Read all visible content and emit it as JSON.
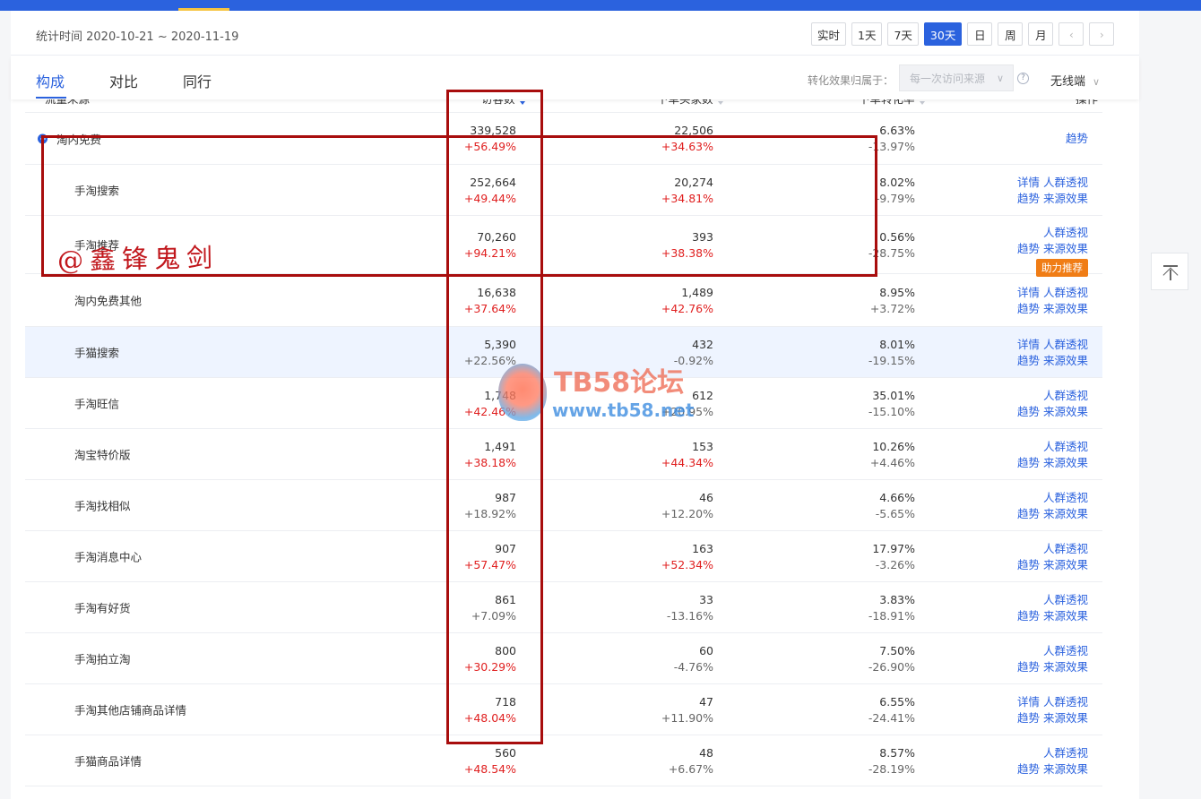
{
  "stat_time": "统计时间 2020-10-21 ~ 2020-11-19",
  "ranges": [
    "实时",
    "1天",
    "7天",
    "30天",
    "日",
    "周",
    "月"
  ],
  "active_range": "30天",
  "tabs": [
    "构成",
    "对比",
    "同行"
  ],
  "attribution_label": "转化效果归属于：",
  "attribution_value": "每一次访问来源",
  "device_value": "无线端",
  "columns": {
    "source": "流量来源",
    "visitors": "访客数",
    "buyers": "下单买家数",
    "conversion": "下单转化率",
    "ops": "操作"
  },
  "rows": [
    {
      "name": "淘内免费",
      "visitors": "339,528",
      "visitors_change": "+56.49%",
      "buyers": "22,506",
      "buyers_change": "+34.63%",
      "conv": "6.63%",
      "conv_change": "-13.97%",
      "ops_line1": "趋势",
      "ops_line2": ""
    },
    {
      "name": "手淘搜索",
      "visitors": "252,664",
      "visitors_change": "+49.44%",
      "buyers": "20,274",
      "buyers_change": "+34.81%",
      "conv": "8.02%",
      "conv_change": "-9.79%",
      "ops_line1": "详情 人群透视",
      "ops_line2": "趋势 来源效果"
    },
    {
      "name": "手淘推荐",
      "visitors": "70,260",
      "visitors_change": "+94.21%",
      "buyers": "393",
      "buyers_change": "+38.38%",
      "conv": "0.56%",
      "conv_change": "-28.75%",
      "ops_line1": "人群透视",
      "ops_line2": "趋势 来源效果",
      "badge": "助力推荐"
    },
    {
      "name": "淘内免费其他",
      "visitors": "16,638",
      "visitors_change": "+37.64%",
      "buyers": "1,489",
      "buyers_change": "+42.76%",
      "conv": "8.95%",
      "conv_change": "+3.72%",
      "ops_line1": "详情 人群透视",
      "ops_line2": "趋势 来源效果"
    },
    {
      "name": "手猫搜索",
      "visitors": "5,390",
      "visitors_change": "+22.56%",
      "buyers": "432",
      "buyers_change": "-0.92%",
      "conv": "8.01%",
      "conv_change": "-19.15%",
      "ops_line1": "详情 人群透视",
      "ops_line2": "趋势 来源效果"
    },
    {
      "name": "手淘旺信",
      "visitors": "1,748",
      "visitors_change": "+42.46%",
      "buyers": "612",
      "buyers_change": "+20.95%",
      "conv": "35.01%",
      "conv_change": "-15.10%",
      "ops_line1": "人群透视",
      "ops_line2": "趋势 来源效果"
    },
    {
      "name": "淘宝特价版",
      "visitors": "1,491",
      "visitors_change": "+38.18%",
      "buyers": "153",
      "buyers_change": "+44.34%",
      "conv": "10.26%",
      "conv_change": "+4.46%",
      "ops_line1": "人群透视",
      "ops_line2": "趋势 来源效果"
    },
    {
      "name": "手淘找相似",
      "visitors": "987",
      "visitors_change": "+18.92%",
      "buyers": "46",
      "buyers_change": "+12.20%",
      "conv": "4.66%",
      "conv_change": "-5.65%",
      "ops_line1": "人群透视",
      "ops_line2": "趋势 来源效果"
    },
    {
      "name": "手淘消息中心",
      "visitors": "907",
      "visitors_change": "+57.47%",
      "buyers": "163",
      "buyers_change": "+52.34%",
      "conv": "17.97%",
      "conv_change": "-3.26%",
      "ops_line1": "人群透视",
      "ops_line2": "趋势 来源效果"
    },
    {
      "name": "手淘有好货",
      "visitors": "861",
      "visitors_change": "+7.09%",
      "buyers": "33",
      "buyers_change": "-13.16%",
      "conv": "3.83%",
      "conv_change": "-18.91%",
      "ops_line1": "人群透视",
      "ops_line2": "趋势 来源效果"
    },
    {
      "name": "手淘拍立淘",
      "visitors": "800",
      "visitors_change": "+30.29%",
      "buyers": "60",
      "buyers_change": "-4.76%",
      "conv": "7.50%",
      "conv_change": "-26.90%",
      "ops_line1": "人群透视",
      "ops_line2": "趋势 来源效果"
    },
    {
      "name": "手淘其他店铺商品详情",
      "visitors": "718",
      "visitors_change": "+48.04%",
      "buyers": "47",
      "buyers_change": "+11.90%",
      "conv": "6.55%",
      "conv_change": "-24.41%",
      "ops_line1": "详情 人群透视",
      "ops_line2": "趋势 来源效果"
    },
    {
      "name": "手猫商品详情",
      "visitors": "560",
      "visitors_change": "+48.54%",
      "buyers": "48",
      "buyers_change": "+6.67%",
      "conv": "8.57%",
      "conv_change": "-28.19%",
      "ops_line1": "人群透视",
      "ops_line2": "趋势 来源效果"
    }
  ],
  "annotation_text": "@鑫锋鬼剑",
  "watermark_title": "TB58论坛",
  "watermark_url": "www.tb58.net",
  "colors": {
    "accent": "#2b62de",
    "positive": "#e02020",
    "highlight_box": "#a80d0d",
    "badge": "#f07d16"
  }
}
